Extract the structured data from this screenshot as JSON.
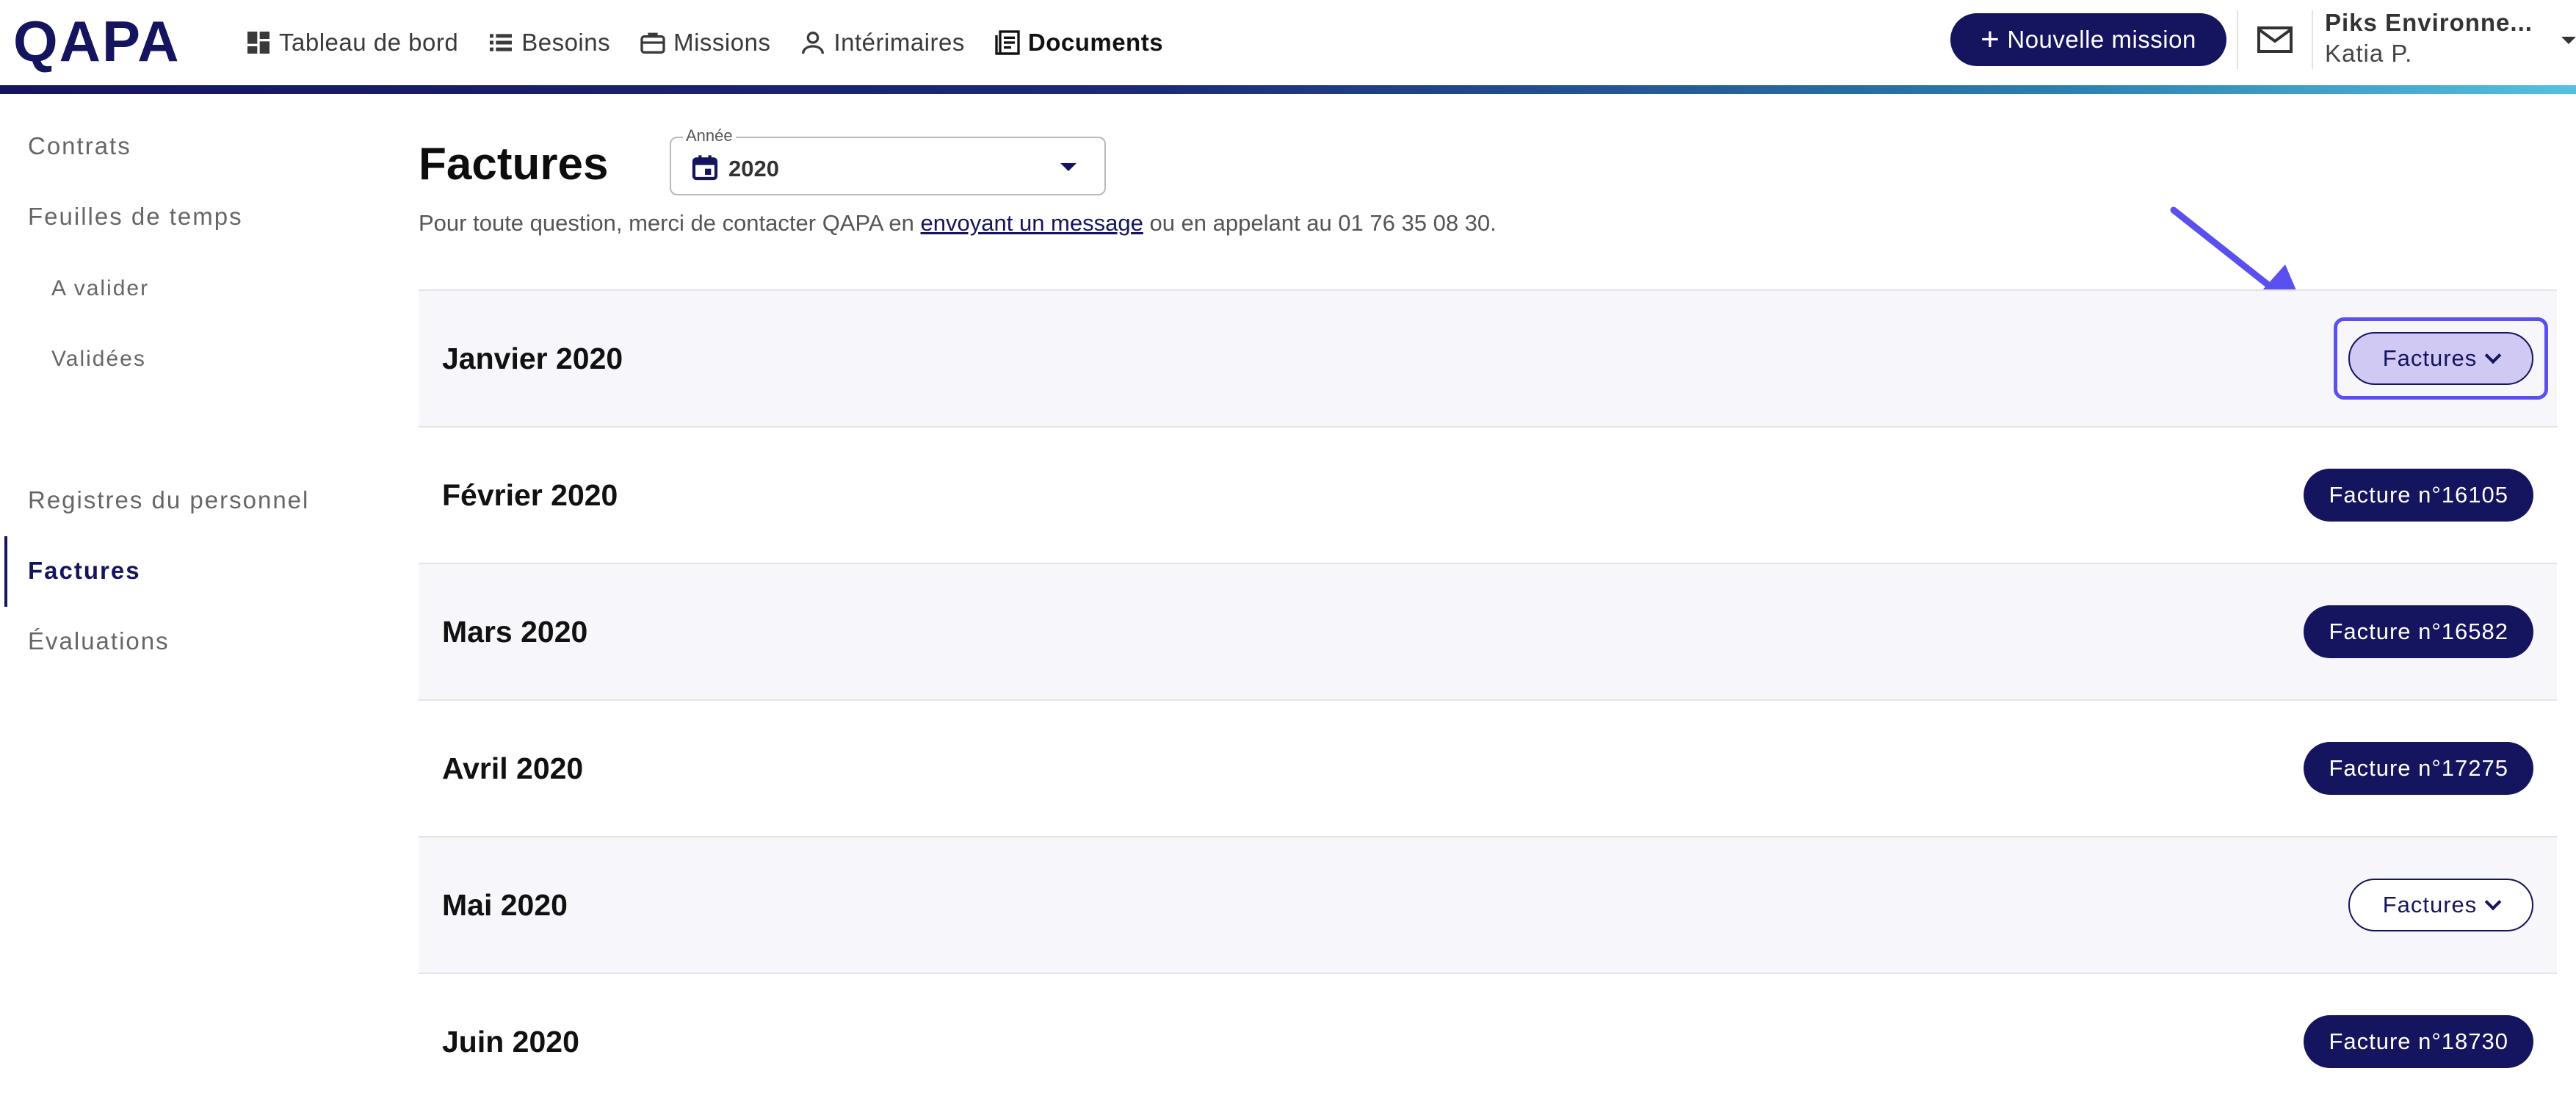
{
  "app": {
    "logo": "QAPA"
  },
  "nav": {
    "items": [
      {
        "label": "Tableau de bord",
        "icon": "dashboard-icon"
      },
      {
        "label": "Besoins",
        "icon": "list-icon"
      },
      {
        "label": "Missions",
        "icon": "briefcase-icon"
      },
      {
        "label": "Intérimaires",
        "icon": "person-icon"
      },
      {
        "label": "Documents",
        "icon": "documents-icon",
        "active": true
      }
    ],
    "new_mission_label": "Nouvelle mission",
    "account": {
      "company": "Piks Environne...",
      "user": "Katia P."
    }
  },
  "sidebar": {
    "contrats": "Contrats",
    "feuilles": "Feuilles de temps",
    "a_valider": "A valider",
    "validees": "Validées",
    "registres": "Registres du personnel",
    "factures": "Factures",
    "evaluations": "Évaluations"
  },
  "main": {
    "title": "Factures",
    "year_label": "Année",
    "year_value": "2020",
    "info_before": "Pour toute question, merci de contacter QAPA en ",
    "info_link": "envoyant un message",
    "info_after": " ou en appelant au 01 76 35 08 30."
  },
  "rows": [
    {
      "month": "Janvier 2020",
      "action": "Factures",
      "type": "dropdown",
      "highlighted": true
    },
    {
      "month": "Février 2020",
      "action": "Facture n°16105",
      "type": "single"
    },
    {
      "month": "Mars 2020",
      "action": "Facture n°16582",
      "type": "single"
    },
    {
      "month": "Avril 2020",
      "action": "Facture n°17275",
      "type": "single"
    },
    {
      "month": "Mai 2020",
      "action": "Factures",
      "type": "dropdown"
    },
    {
      "month": "Juin 2020",
      "action": "Facture n°18730",
      "type": "single"
    }
  ],
  "colors": {
    "primary": "#15145f",
    "accent": "#5b4ff0",
    "highlight_fill": "#cfc9f4"
  }
}
